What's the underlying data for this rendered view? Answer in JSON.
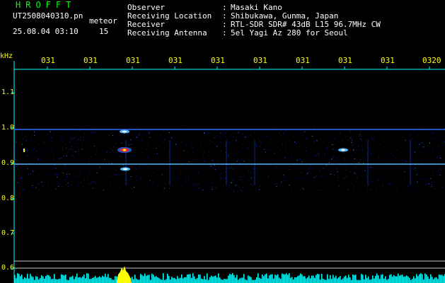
{
  "header": {
    "title": "HROFFT",
    "filename": "UT2508040310.pn",
    "meteor_label": "meteor",
    "date_time": "25.08.04 03:10",
    "meteor_count": "15"
  },
  "info": [
    {
      "label": "Observer",
      "colon": ":",
      "value": "Masaki Kano"
    },
    {
      "label": "Receiving Location",
      "colon": ":",
      "value": "Shibukawa, Gunma, Japan"
    },
    {
      "label": "Receiver",
      "colon": ":",
      "value": "RTL-SDR SDR# 43dB L15 96.7MHz CW"
    },
    {
      "label": "Receiving Antenna",
      "colon": ":",
      "value": "5el Yagi Az 280 for Seoul"
    }
  ],
  "axis": {
    "unit_label": "kHz",
    "y_ticks": [
      "1.1",
      "1.0",
      "0.9",
      "0.8",
      "0.7",
      "0.6"
    ],
    "x_ticks": [
      "031",
      "031",
      "031",
      "031",
      "031",
      "031",
      "031",
      "031",
      "031",
      "0320"
    ]
  },
  "colors": {
    "background": "#000000",
    "title": "#00ff00",
    "text": "#ffffff",
    "tick_text": "#ffff00",
    "axis_line": "#00ffff",
    "reference_line": "#c8c8c8",
    "signal_line": "#2f6bff",
    "signal_hot": "#ff2020",
    "meteor_blip": "#ffff00",
    "noise_strip": "#00ffff"
  },
  "chart_data": {
    "type": "heatmap",
    "y_unit": "kHz",
    "y_range": [
      0.58,
      1.2
    ],
    "carrier_lines_khz": [
      1.0,
      0.9
    ],
    "echoes": [
      {
        "x_tick_index": 2.3,
        "freq_khz": 0.94,
        "strength": "strong"
      },
      {
        "x_tick_index": 2.3,
        "freq_khz": 0.99,
        "strength": "medium"
      },
      {
        "x_tick_index": 2.3,
        "freq_khz": 0.89,
        "strength": "medium"
      },
      {
        "x_tick_index": 7.5,
        "freq_khz": 0.945,
        "strength": "weak"
      },
      {
        "x_tick_index": 0.1,
        "freq_khz": 0.945,
        "strength": "weak"
      }
    ]
  }
}
